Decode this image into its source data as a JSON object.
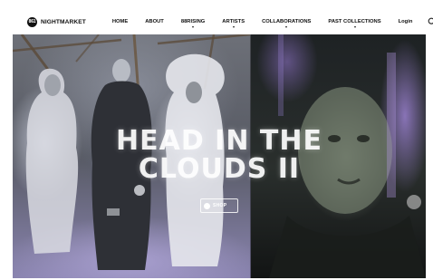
{
  "brand": {
    "logo_mark": "861",
    "name": "NIGHTMARKET"
  },
  "nav": {
    "items": [
      {
        "label": "HOME",
        "dropdown": false
      },
      {
        "label": "ABOUT",
        "dropdown": false
      },
      {
        "label": "88RISING",
        "dropdown": true
      },
      {
        "label": "ARTISTS",
        "dropdown": true
      },
      {
        "label": "COLLABORATIONS",
        "dropdown": true
      },
      {
        "label": "PAST COLLECTIONS",
        "dropdown": true
      }
    ],
    "login_label": "Login",
    "icons": [
      "search-icon",
      "cart-icon"
    ]
  },
  "hero": {
    "title_line_1": "HEAD IN THE",
    "title_line_2": "CLOUDS II",
    "button_label": "SHOP"
  },
  "colors": {
    "nav_text": "#111111",
    "nav_background": "#ffffff",
    "hero_text": "#ffffff",
    "smoke_purple": "#a89ad8"
  }
}
